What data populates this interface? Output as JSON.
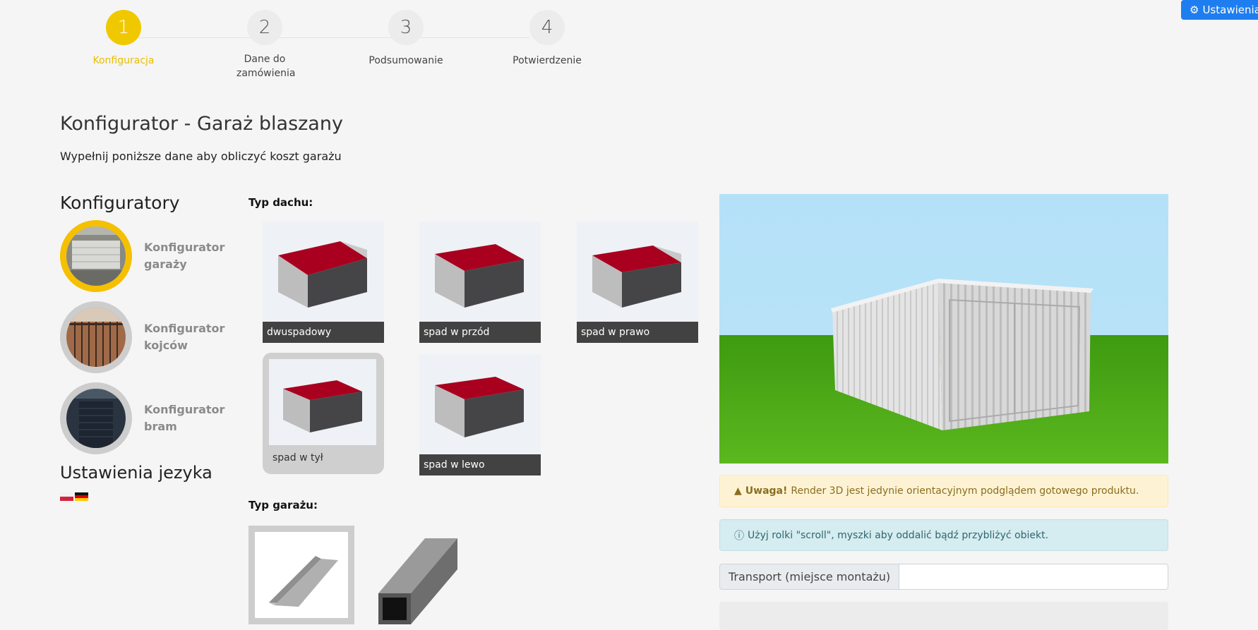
{
  "settings_button": {
    "icon": "gears-icon",
    "label": "Ustawienia"
  },
  "steps": [
    {
      "number": "1",
      "label": "Konfiguracja",
      "active": true
    },
    {
      "number": "2",
      "label": "Dane do zamówienia",
      "active": false
    },
    {
      "number": "3",
      "label": "Podsumowanie",
      "active": false
    },
    {
      "number": "4",
      "label": "Potwierdzenie",
      "active": false
    }
  ],
  "page": {
    "title": "Konfigurator - Garaż blaszany",
    "subtitle": "Wypełnij poniższe dane aby obliczyć koszt garażu"
  },
  "sidebar": {
    "heading": "Konfiguratory",
    "items": [
      {
        "label": "Konfigurator garaży",
        "active": true
      },
      {
        "label": "Konfigurator kojców",
        "active": false
      },
      {
        "label": "Konfigurator bram",
        "active": false
      }
    ],
    "language_heading": "Ustawienia jezyka",
    "flags": [
      "flag-pl-icon",
      "flag-de-icon"
    ]
  },
  "roof": {
    "heading": "Typ dachu:",
    "options": [
      {
        "label": "dwuspadowy",
        "selected": false
      },
      {
        "label": "spad w przód",
        "selected": false
      },
      {
        "label": "spad w prawo",
        "selected": false
      },
      {
        "label": "spad w tył",
        "selected": true
      },
      {
        "label": "spad w lewo",
        "selected": false
      }
    ]
  },
  "garage_type": {
    "heading": "Typ garażu:",
    "options": [
      {
        "icon": "angle-profile-icon",
        "selected": true
      },
      {
        "icon": "square-profile-icon",
        "selected": false
      }
    ]
  },
  "alerts": {
    "warning_strong": "Uwaga!",
    "warning_text": "Render 3D jest jedynie orientacyjnym podglądem gotowego produktu.",
    "info_text": "Użyj rolki \"scroll\", myszki aby oddalić bądź przybliżyć obiekt."
  },
  "transport": {
    "label": "Transport (miejsce montażu)",
    "value": ""
  },
  "colors": {
    "accent": "#f0c800",
    "primary": "#1e7ef0",
    "roof_red": "#a8001e"
  }
}
